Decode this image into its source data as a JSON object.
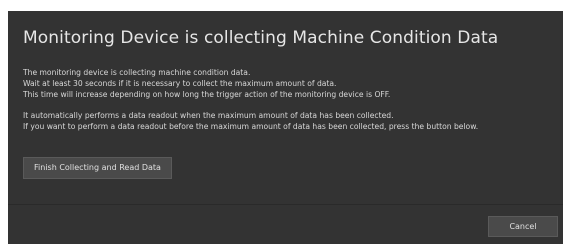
{
  "dialog": {
    "title": "Monitoring Device is collecting Machine Condition Data",
    "paragraph1": [
      "The monitoring device is collecting machine condition data.",
      "Wait at least 30 seconds if it is necessary to collect the maximum amount of data.",
      "This time will increase depending on how long the trigger action of the monitoring device is OFF."
    ],
    "paragraph2": [
      "It automatically performs a data readout when the maximum amount of data has been collected.",
      "If you want to perform a data readout before the maximum amount of data has been collected, press the button below."
    ],
    "finish_button_label": "Finish Collecting and Read Data",
    "cancel_button_label": "Cancel"
  },
  "colors": {
    "background": "#333333",
    "button": "#4a4a4a",
    "text": "#d8d8d8"
  }
}
